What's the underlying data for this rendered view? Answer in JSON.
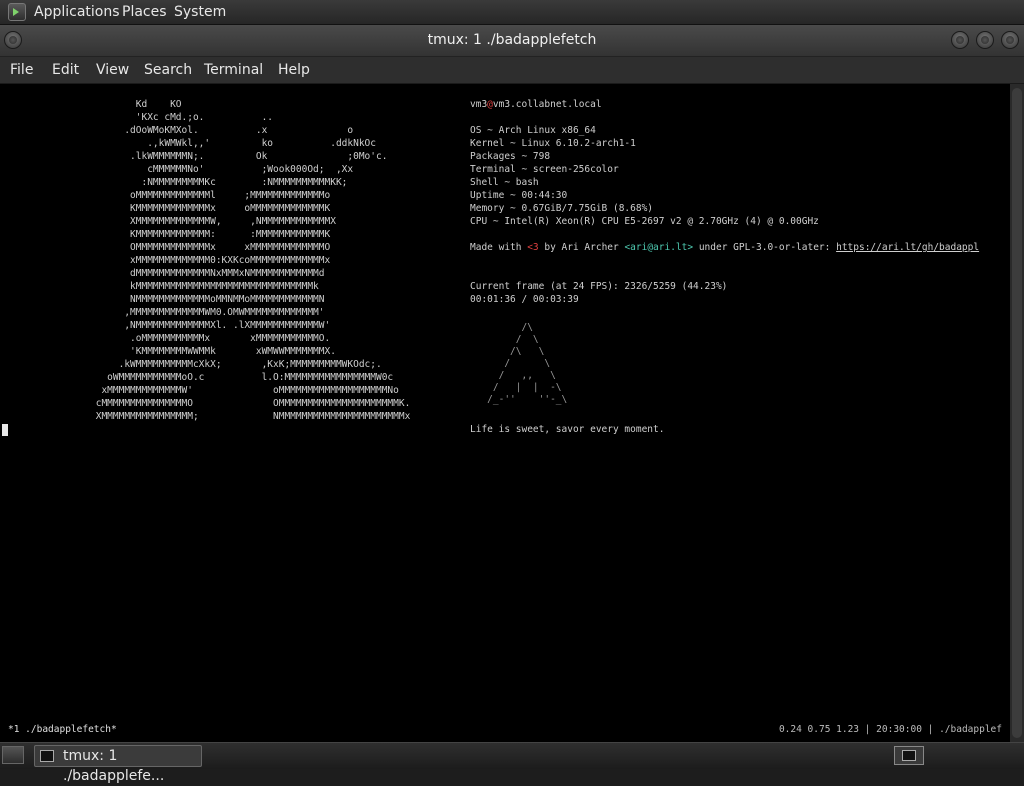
{
  "panel": {
    "menus": [
      "Applications",
      "Places",
      "System"
    ]
  },
  "window": {
    "title": "tmux: 1 ./badapplefetch"
  },
  "menubar": {
    "items": [
      "File",
      "Edit",
      "View",
      "Search",
      "Terminal",
      "Help"
    ]
  },
  "terminal": {
    "ascii_art": [
      "        Kd    KO",
      "        'KXc cMd.;o.          ..",
      "      .dOoWMoKMXol.          .x              o",
      "          .,kWMWkl,,'         ko          .ddkNkOc",
      "       .lkWMMMMMMN;.         Ok              ;0Mo'c.",
      "          cMMMMMMNo'          ;Wook000Od;  ,Xx",
      "         :NMMMMMMMMMKc        :NMMMMMMMMMMKK;",
      "       oMMMMMMMMMMMMMl     ;MMMMMMMMMMMMMo",
      "       KMMMMMMMMMMMMMx     oMMMMMMMMMMMMMK",
      "       XMMMMMMMMMMMMMW,     ,NMMMMMMMMMMMMX",
      "       KMMMMMMMMMMMMM:      :MMMMMMMMMMMMK",
      "       OMMMMMMMMMMMMMx     xMMMMMMMMMMMMMO",
      "       xMMMMMMMMMMMMM0:KXKcoMMMMMMMMMMMMMx",
      "       dMMMMMMMMMMMMMNxMMMxNMMMMMMMMMMMMd",
      "       kMMMMMMMMMMMMMMMMMMMMMMMMMMMMMMMk",
      "       NMMMMMMMMMMMMMoMMNMMoMMMMMMMMMMMMN",
      "      ,MMMMMMMMMMMMMWM0.OMWMMMMMMMMMMMMM'",
      "      ,NMMMMMMMMMMMMMXl. .lXMMMMMMMMMMMMW'",
      "       .oMMMMMMMMMMMx       xMMMMMMMMMMMO.",
      "       'KMMMMMMMMWWMMk       xWMWWMMMMMMMX.",
      "     .kWMMMMMMMMMMcXkX;       ,KxK;MMMMMMMMMWKOdc;.",
      "   oWMMMMMMMMMMMoO.c          l.O:MMMMMMMMMMMMMMMMW0c",
      "  xMMMMMMMMMMMMMW'              oMMMMMMMMMMMMMMMMMMMNo",
      " cMMMMMMMMMMMMMMMO              OMMMMMMMMMMMMMMMMMMMMMK.",
      " XMMMMMMMMMMMMMMMM;             NMMMMMMMMMMMMMMMMMMMMMMx"
    ],
    "info": {
      "header_user": "vm3",
      "header_at": "@",
      "header_host": "vm3.collabnet.local",
      "os": "OS ~ Arch Linux x86_64",
      "kernel": "Kernel ~ Linux 6.10.2-arch1-1",
      "packages": "Packages ~ 798",
      "terminal": "Terminal ~ screen-256color",
      "shell": "Shell ~ bash",
      "uptime": "Uptime ~ 00:44:30",
      "memory": "Memory ~ 0.67GiB/7.75GiB (8.68%)",
      "cpu": "CPU ~ Intel(R) Xeon(R) CPU E5-2697 v2 @ 2.70GHz (4) @ 0.00GHz",
      "made_prefix": "Made with ",
      "made_heart": "<3",
      "made_mid": " by Ari Archer ",
      "made_email": "<ari@ari.lt>",
      "made_suffix": " under GPL-3.0-or-later: ",
      "made_link": "https://ari.lt/gh/badappl",
      "frame": "Current frame (at 24 FPS): 2326/5259 (44.23%)",
      "time": "00:01:36 / 00:03:39",
      "motto": "Life is sweet, savor every moment."
    },
    "logo_art": [
      "         /\\",
      "        /  \\",
      "       /\\   \\",
      "      /      \\",
      "     /   ,,   \\",
      "    /   |  |  -\\",
      "   /_-''    ''-_\\"
    ]
  },
  "tmux": {
    "window_label": "*1 ./badapplefetch*",
    "status_right": "0.24 0.75 1.23 | 20:30:00 | ./badapplef"
  },
  "taskbar": {
    "task_label": "tmux: 1 ./badapplefe..."
  }
}
